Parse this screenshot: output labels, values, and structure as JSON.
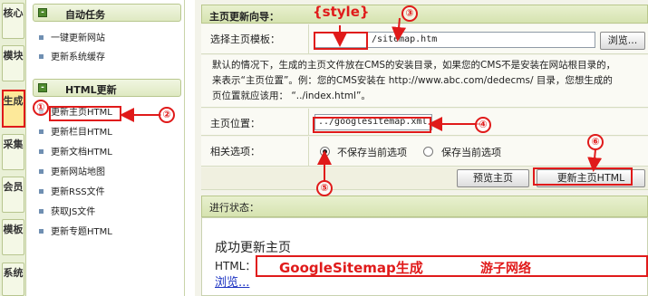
{
  "vtabs": [
    "核心",
    "模块",
    "生成",
    "采集",
    "会员",
    "模板",
    "系统"
  ],
  "menu": {
    "section1_title": "自动任务",
    "section1_items": [
      "一键更新网站",
      "更新系统缓存"
    ],
    "section2_title": "HTML更新",
    "section2_items": [
      "更新主页HTML",
      "更新栏目HTML",
      "更新文档HTML",
      "更新网站地图",
      "更新RSS文件",
      "获取JS文件",
      "更新专题HTML"
    ]
  },
  "main": {
    "wizard_title": "主页更新向导：",
    "template_label": "选择主页模板：",
    "template_value": "/sitemap.htm",
    "browse_button": "浏览...",
    "desc_line1": "默认的情况下，生成的主页文件放在CMS的安装目录，如果您的CMS不是安装在网站根目录的，",
    "desc_line2": "来表示“主页位置”。例：您的CMS安装在 http://www.abc.com/dedecms/ 目录，您想生成的",
    "desc_line3": "页位置就应该用： “../index.html”。",
    "position_label": "主页位置：",
    "position_value": "../googlesitemap.xml",
    "options_label": "相关选项：",
    "radio_nosave": "不保存当前选项",
    "radio_save": "保存当前选项",
    "preview_button": "预览主页",
    "update_button": "更新主页HTML",
    "progress_label": "进行状态：",
    "success_text": "成功更新主页",
    "html_label": "HTML：",
    "browse_link": "浏览..."
  },
  "annotations": {
    "style_tag": "{style}",
    "n1": "①",
    "n2": "②",
    "n3": "③",
    "n4": "④",
    "n5": "⑤",
    "n6": "⑥",
    "banner_text": "GoogleSitemap生成",
    "watermark": "游子网络",
    "accent_color": "#e01a1a"
  }
}
